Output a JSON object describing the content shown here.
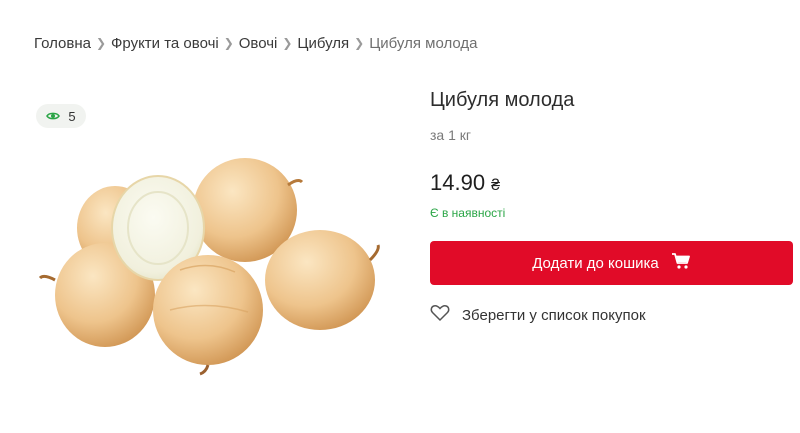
{
  "breadcrumb": {
    "items": [
      "Головна",
      "Фрукти та овочі",
      "Овочі",
      "Цибуля",
      "Цибуля молода"
    ]
  },
  "views": {
    "count": "5",
    "icon": "eye-icon"
  },
  "product": {
    "title": "Цибуля молода",
    "unit": "за 1 кг",
    "price": "14.90",
    "currency": "₴",
    "stock": "Є в наявності",
    "image": "onions-image"
  },
  "actions": {
    "add_to_cart": "Додати до кошика",
    "save_to_list": "Зберегти у список покупок"
  },
  "colors": {
    "accent": "#e10b28",
    "in_stock": "#2aa546",
    "view_icon": "#2aa546"
  }
}
